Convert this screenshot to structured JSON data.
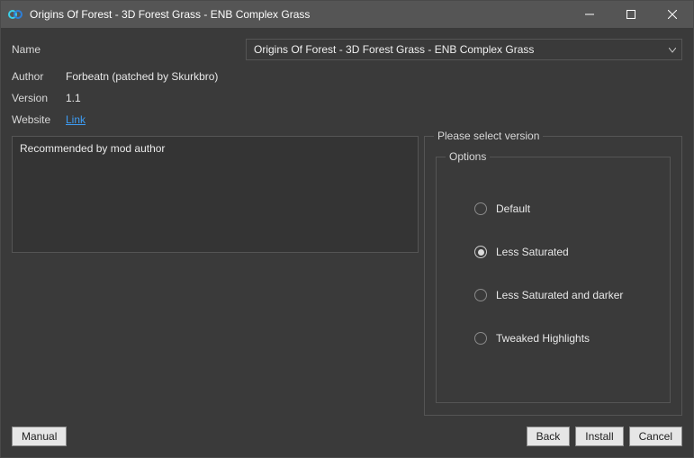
{
  "titlebar": {
    "title": "Origins Of Forest - 3D Forest Grass - ENB Complex Grass"
  },
  "form": {
    "name_label": "Name",
    "name_value": "Origins Of Forest - 3D Forest Grass - ENB Complex Grass",
    "author_label": "Author",
    "author_value": "Forbeatn (patched by Skurkbro)",
    "version_label": "Version",
    "version_value": "1.1",
    "website_label": "Website",
    "website_link_text": "Link",
    "description": "Recommended by mod author"
  },
  "version_fieldset": {
    "legend": "Please select version",
    "options_legend": "Options",
    "options": [
      {
        "label": "Default",
        "selected": false
      },
      {
        "label": "Less Saturated",
        "selected": true
      },
      {
        "label": "Less Saturated and darker",
        "selected": false
      },
      {
        "label": "Tweaked Highlights",
        "selected": false
      }
    ]
  },
  "buttons": {
    "manual": "Manual",
    "back": "Back",
    "install": "Install",
    "cancel": "Cancel"
  }
}
